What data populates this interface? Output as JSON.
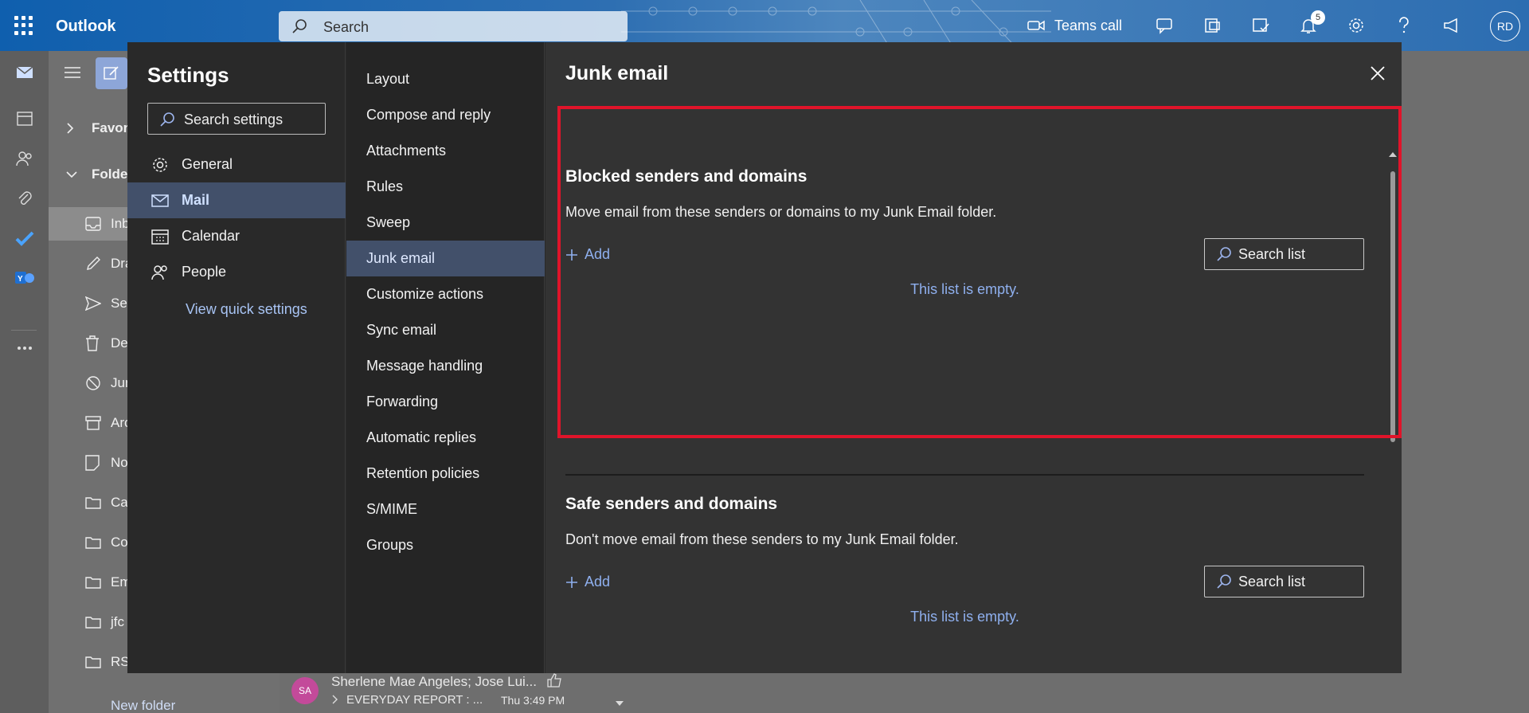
{
  "app": {
    "name": "Outlook"
  },
  "topbar": {
    "search_placeholder": "Search",
    "teams_label": "Teams call",
    "notification_count": "5",
    "avatar_initials": "RD"
  },
  "folders": {
    "favorites": "Favor",
    "folders": "Folde",
    "items": [
      "Inb",
      "Dra",
      "Sen",
      "De",
      "Jun",
      "Arc",
      "No",
      "Cas",
      "Co",
      "Em",
      "jfc",
      "RS"
    ],
    "new_folder": "New folder"
  },
  "message_fragment": {
    "avatar": "SA",
    "sender": "Sherlene Mae Angeles; Jose Lui...",
    "subject": "EVERYDAY REPORT : ...",
    "time": "Thu 3:49 PM"
  },
  "settings": {
    "title": "Settings",
    "search_placeholder": "Search settings",
    "categories": [
      {
        "label": "General",
        "icon": "gear-icon"
      },
      {
        "label": "Mail",
        "icon": "mail-icon"
      },
      {
        "label": "Calendar",
        "icon": "calendar-icon"
      },
      {
        "label": "People",
        "icon": "people-icon"
      }
    ],
    "quick_settings_link": "View quick settings",
    "mail_subcategories": [
      "Layout",
      "Compose and reply",
      "Attachments",
      "Rules",
      "Sweep",
      "Junk email",
      "Customize actions",
      "Sync email",
      "Message handling",
      "Forwarding",
      "Automatic replies",
      "Retention policies",
      "S/MIME",
      "Groups"
    ],
    "selected_category": "Mail",
    "selected_subcategory": "Junk email"
  },
  "junk_panel": {
    "title": "Junk email",
    "blocked": {
      "title": "Blocked senders and domains",
      "description": "Move email from these senders or domains to my Junk Email folder.",
      "add_label": "Add",
      "search_label": "Search list",
      "empty_text": "This list is empty."
    },
    "safe": {
      "title": "Safe senders and domains",
      "description": "Don't move email from these senders to my Junk Email folder.",
      "add_label": "Add",
      "search_label": "Search list",
      "empty_text": "This list is empty."
    }
  },
  "colors": {
    "accent": "#8fb0ef",
    "selection": "#42506a",
    "highlight_box": "#e0142a"
  }
}
